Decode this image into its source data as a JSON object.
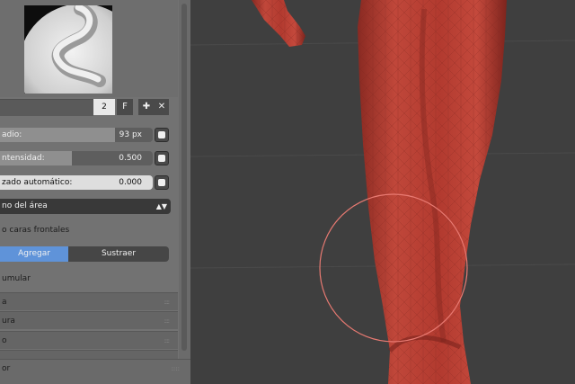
{
  "brush": {
    "users_count": "2",
    "fake_user_label": "F",
    "add_icon": "plus-icon",
    "remove_icon": "x-icon"
  },
  "settings": {
    "radius": {
      "label": "adio:",
      "value": "93 px",
      "fraction": 0.75
    },
    "strength": {
      "label": "ntensidad:",
      "value": "0.500",
      "fraction": 0.47
    },
    "autosmooth": {
      "label": "zado automático:",
      "value": "0.000"
    },
    "area_plane": {
      "label": "no del área"
    },
    "front_faces_only": "o caras frontales",
    "direction": {
      "add_label": "Agregar",
      "subtract_label": "Sustraer",
      "active": "add"
    },
    "accumulate": "umular"
  },
  "subpanels": [
    {
      "label": "a"
    },
    {
      "label": "ura"
    },
    {
      "label": "o"
    }
  ],
  "footer": {
    "label": "or"
  },
  "colors": {
    "accent": "#5f93d9",
    "mesh": "#b83a2e",
    "brush_cursor": "#e87a72"
  }
}
